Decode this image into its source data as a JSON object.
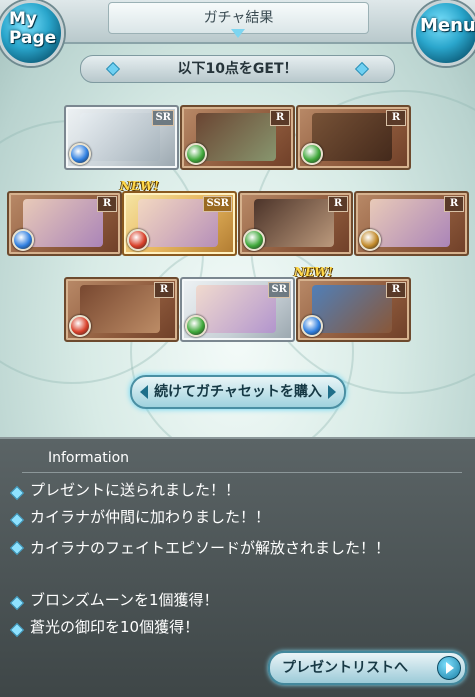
{
  "header": {
    "title": "ガチャ結果",
    "mypage_line1": "My",
    "mypage_line2": "Page",
    "menu_label": "Menu"
  },
  "banner": {
    "text": "以下10点をGET！"
  },
  "cards": [
    {
      "rarity": "SR",
      "frame": "silver",
      "element": "water",
      "art": "bow",
      "new": false
    },
    {
      "rarity": "R",
      "frame": "bronze",
      "element": "wind",
      "art": "axe",
      "new": false
    },
    {
      "rarity": "R",
      "frame": "bronze",
      "element": "wind",
      "art": "beast",
      "new": false
    },
    {
      "rarity": "R",
      "frame": "bronze",
      "element": "water",
      "art": "character",
      "new": false
    },
    {
      "rarity": "SSR",
      "frame": "gold",
      "element": "fire",
      "art": "character",
      "new": true
    },
    {
      "rarity": "R",
      "frame": "bronze",
      "element": "wind",
      "art": "blade",
      "new": false
    },
    {
      "rarity": "R",
      "frame": "bronze",
      "element": "earth",
      "art": "character",
      "new": false
    },
    {
      "rarity": "R",
      "frame": "bronze",
      "element": "fire",
      "art": "sword",
      "new": false
    },
    {
      "rarity": "SR",
      "frame": "silver",
      "element": "wind",
      "art": "character",
      "new": false
    },
    {
      "rarity": "R",
      "frame": "bronze",
      "element": "water",
      "art": "mirror",
      "new": true
    }
  ],
  "new_label": "NEW!",
  "buy_button": {
    "label": "続けてガチャセットを購入"
  },
  "info": {
    "title": "Information",
    "messages": [
      "プレゼントに送られました！！",
      "カイラナが仲間に加わりました！！",
      "カイラナのフェイトエピソードが解放されました！！",
      "ブロンズムーンを1個獲得！",
      "蒼光の御印を10個獲得！"
    ]
  },
  "present_button": {
    "label": "プレゼントリストへ"
  },
  "colors": {
    "fire": "#d9402a",
    "water": "#2f7fe0",
    "wind": "#3fa83a",
    "earth": "#c28a2a",
    "accent": "#5fd4f6"
  }
}
